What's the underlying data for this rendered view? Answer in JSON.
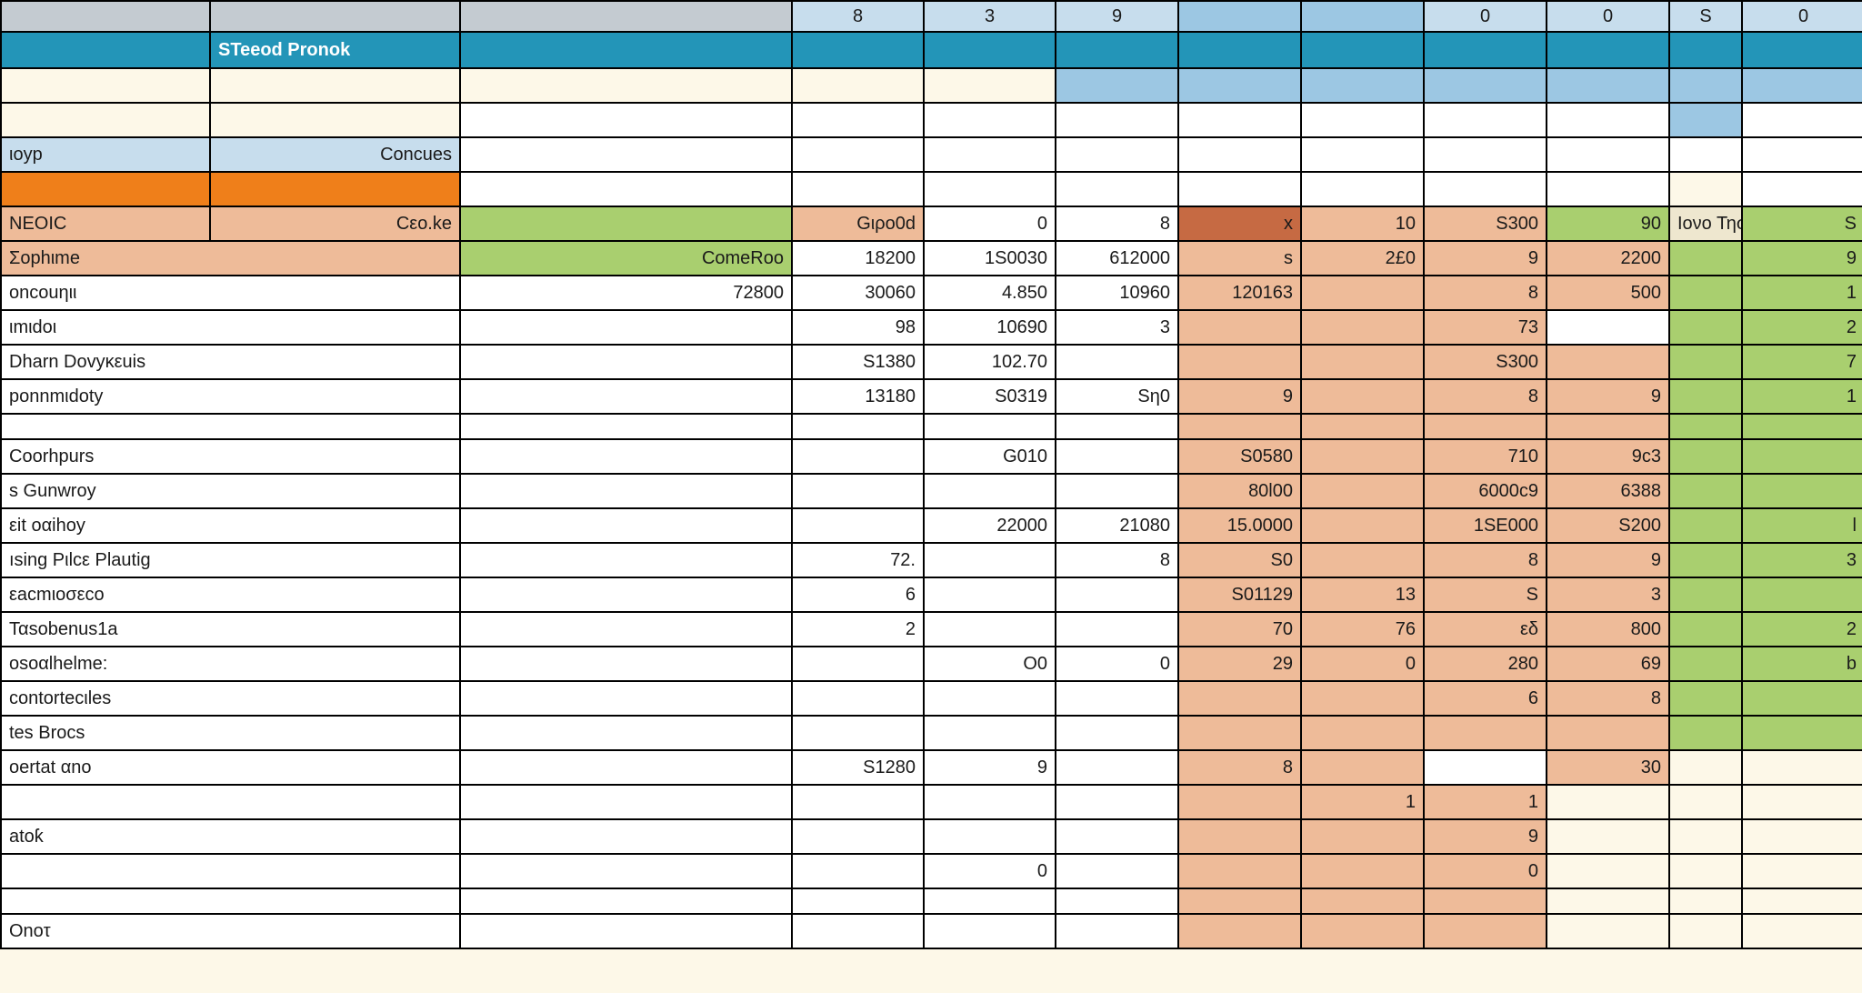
{
  "topHeaders": [
    "",
    "",
    "",
    "8",
    "3",
    "9",
    "",
    "",
    "0",
    "0",
    "S",
    "0"
  ],
  "tealTitle": "STeeod Pronok",
  "blueRowLabels": {
    "left": "ιoyp",
    "right": "Concues"
  },
  "greenHeaderRight": "Ιονο Τησει",
  "row_nedic": {
    "label": "NEOIC",
    "sub": "Cεo.ke",
    "c3": "Gιρo0d",
    "c4": "0",
    "c5": "8",
    "c6": "x",
    "c7": "10",
    "c8": "S300",
    "c9": "90",
    "c11": "S"
  },
  "row_oghme": {
    "label": "Σophιme",
    "c2": "ComeRoo",
    "c3": "18200",
    "c4": "1S0030",
    "c5": "612000",
    "c6": "s",
    "c7": "2£0",
    "c8": "9",
    "c9": "2200",
    "c11": "9"
  },
  "row_oncouni": {
    "label": "oncouηιι",
    "c2": "72800",
    "c3": "30060",
    "c4": "4.850",
    "c5": "10960",
    "c6": "120163",
    "c8": "8",
    "c9": "500",
    "c11": "1"
  },
  "row_mido": {
    "label": "ιmιdoι",
    "c3": "98",
    "c4": "10690",
    "c5": "3",
    "c8": "73",
    "c11": "2"
  },
  "row_dharn": {
    "label": "Dharn Dovyκεuis",
    "c3": "S1380",
    "c4": "102.70",
    "c8": "S300",
    "c11": "7"
  },
  "row_omnid": {
    "label": "ponnmιdoty",
    "c3": "13180",
    "c4": "S0319",
    "c5": "Sη0",
    "c6": "9",
    "c8": "8",
    "c9": "9",
    "c11": "1"
  },
  "row_coohp": {
    "label": "Coorhpurs",
    "c4": "G010",
    "c6": "S0580",
    "c8": "710",
    "c9": "9c3"
  },
  "row_gunw": {
    "label": "s Gunwroy",
    "c6": "80l00",
    "c8": "6000c9",
    "c9": "6388"
  },
  "row_eitou": {
    "label": "εit oαihoy",
    "c4": "22000",
    "c5": "21080",
    "c6": "15.0000",
    "c8": "1SE000",
    "c9": "S200",
    "c11": "l"
  },
  "row_sing": {
    "label": "ısing Pιlcε Plautig",
    "c3": "72.",
    "c5": "8",
    "c6": "S0",
    "c8": "8",
    "c9": "9",
    "c11": "3"
  },
  "row_eacmo": {
    "label": "εacmιoσεco",
    "c3": "6",
    "c6": "S01129",
    "c7": "13",
    "c8": "S",
    "c9": "3"
  },
  "row_tabo": {
    "label": "Ταsobenus1a",
    "c3": "2",
    "c6": "70",
    "c7": "76",
    "c8": "εδ",
    "c9": "800",
    "c11": "2"
  },
  "row_osoalh": {
    "label": "osoαlhelme:",
    "c4": "O0",
    "c5": "0",
    "c6": "29",
    "c7": "0",
    "c8": "280",
    "c9": "69",
    "c11": "b"
  },
  "row_contor": {
    "label": "contortecιles",
    "c8": "6",
    "c9": "8"
  },
  "row_tes": {
    "label": "tes Brocs"
  },
  "row_oeuta": {
    "label": "oertat αno",
    "c3": "S1280",
    "c4": "9",
    "c6": "8",
    "c9": "30"
  },
  "row_r23": {
    "c7": "1",
    "c8": "1"
  },
  "row_atok": {
    "label": "atoƙ",
    "c8": "9"
  },
  "row_r25": {
    "c4": "0",
    "c8": "0"
  },
  "row_onor": {
    "label": "Onoτ"
  }
}
